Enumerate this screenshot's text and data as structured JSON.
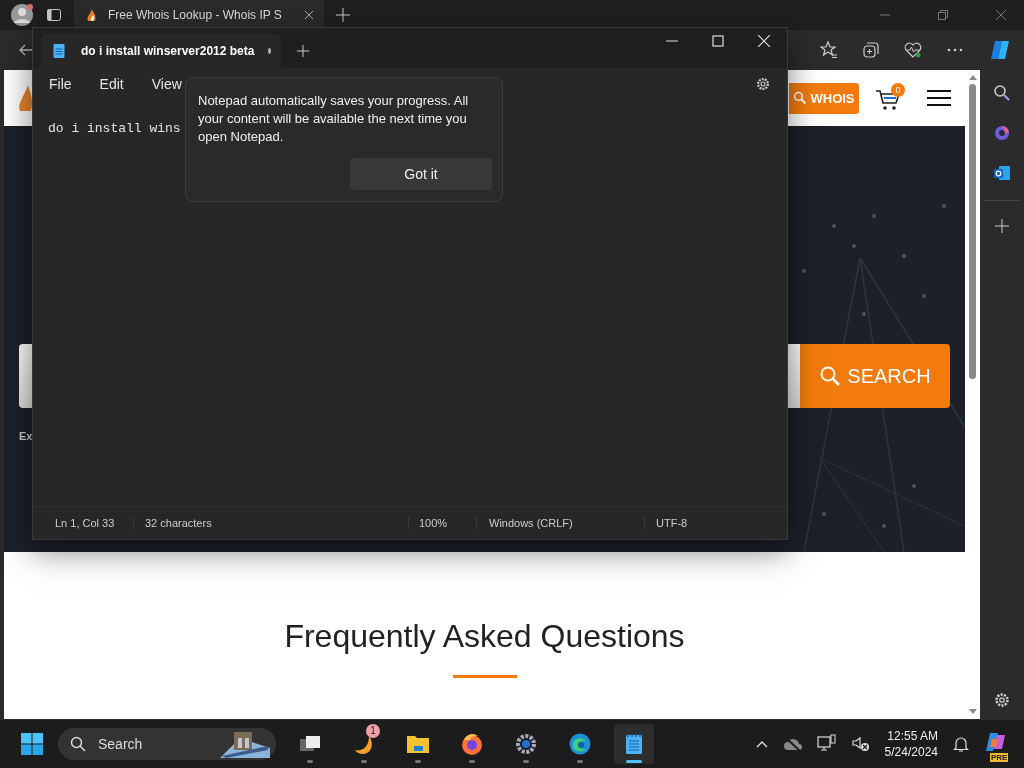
{
  "browser": {
    "tabs": [
      {
        "title": "Free Whois Lookup - Whois IP S",
        "selected": true
      }
    ]
  },
  "website": {
    "whois_button": "WHOIS",
    "cart_count": "0",
    "search_button": "SEARCH",
    "hint_text": "Ex",
    "faq_title": "Frequently Asked Questions"
  },
  "notepad": {
    "tabs": [
      {
        "title": "do i install winserver2012 beta",
        "selected": true,
        "unsaved": true
      }
    ],
    "menu": [
      "File",
      "Edit",
      "View"
    ],
    "text": "do i install wins",
    "popup": {
      "message": "Notepad automatically saves your progress. All your content will be available the next time you open Notepad.",
      "button": "Got it"
    },
    "status_bar": {
      "position": "Ln 1, Col 33",
      "characters": "32 characters",
      "zoom": "100%",
      "line_ending": "Windows (CRLF)",
      "encoding": "UTF-8"
    }
  },
  "taskbar": {
    "search_placeholder": "Search",
    "apps": [
      {
        "kind": "task-view",
        "selected": false
      },
      {
        "kind": "app",
        "selected": false,
        "badge": "1"
      },
      {
        "kind": "explorer",
        "selected": false
      },
      {
        "kind": "firefox",
        "selected": false
      },
      {
        "kind": "settings",
        "selected": false
      },
      {
        "kind": "edge",
        "selected": false
      },
      {
        "kind": "notepad",
        "selected": true
      }
    ],
    "time": "12:55 AM",
    "date": "5/24/2024",
    "copilot_badge": "PRE"
  }
}
